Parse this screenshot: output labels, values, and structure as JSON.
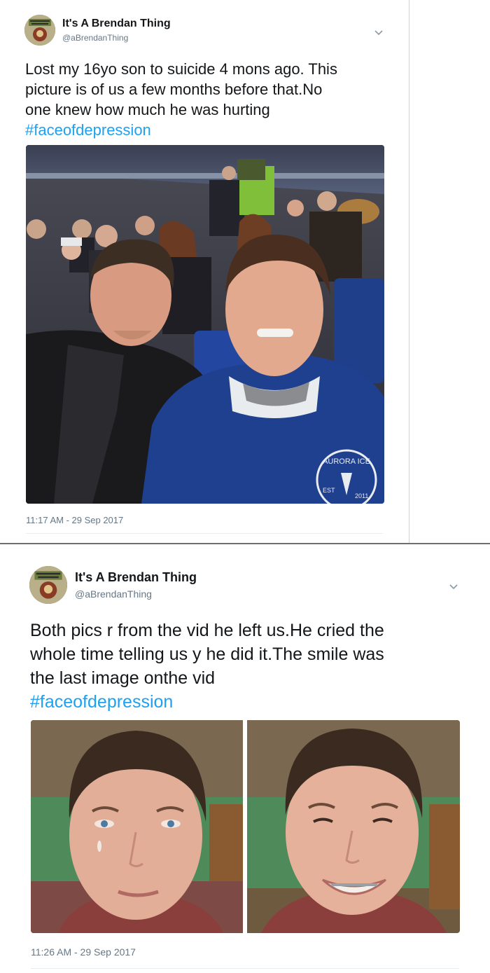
{
  "tweets": [
    {
      "display_name": "It's A Brendan Thing",
      "handle": "@aBrendanThing",
      "avatar_icon": "profile-avatar",
      "menu_icon": "chevron-down-icon",
      "text_lines": [
        "Lost my 16yo son to suicide 4 mons ago. This",
        "picture is of us a few months before that.No",
        "one knew how much he was hurting"
      ],
      "hashtag": "#faceofdepression",
      "media_description_icon": "stadium-selfie-photo",
      "photo_text": {
        "hoodie_logo_arc": "AURORA ICE",
        "hoodie_logo_left": "EST",
        "hoodie_logo_right": "2011"
      },
      "timestamp": "11:17 AM - 29 Sep 2017"
    },
    {
      "display_name": "It's A Brendan Thing",
      "handle": "@aBrendanThing",
      "avatar_icon": "profile-avatar",
      "menu_icon": "chevron-down-icon",
      "text_lines": [
        "Both pics r from the vid he left us.He cried the",
        "whole time telling us y he did it.The smile was",
        "the last image onthe vid"
      ],
      "hashtag": "#faceofdepression",
      "media_description_icon": "video-frames-photos",
      "timestamp": "11:26 AM - 29 Sep 2017"
    }
  ],
  "colors": {
    "link": "#1da1f2",
    "secondary_text": "#657786",
    "primary_text": "#14171a",
    "divider": "#e6ecf0"
  }
}
